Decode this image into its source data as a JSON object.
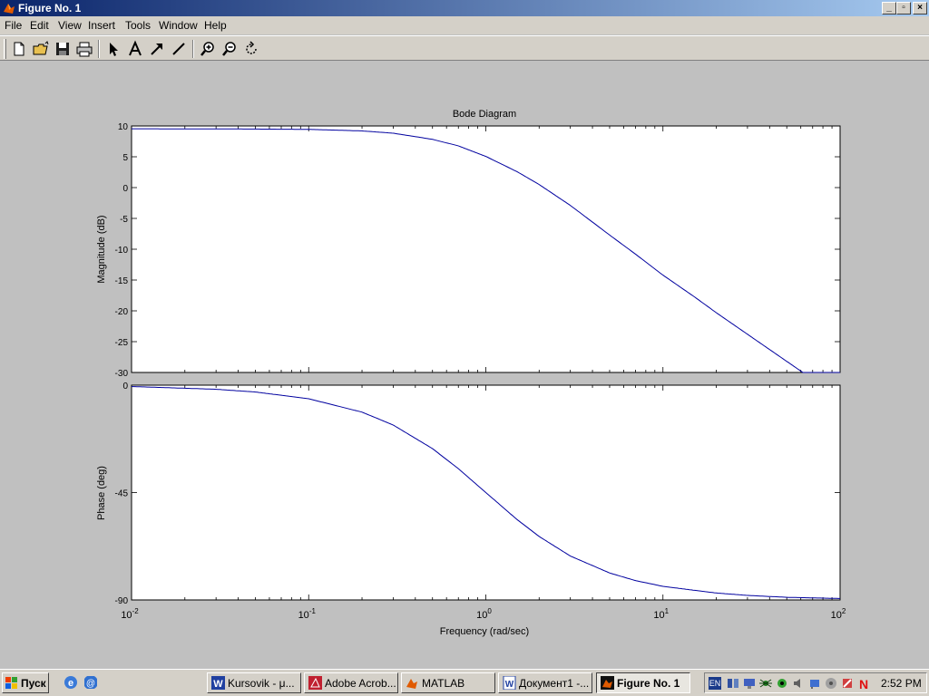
{
  "window": {
    "title": "Figure No. 1",
    "controls": {
      "minimize": "_",
      "maximize": "▫",
      "close": "×"
    }
  },
  "menu": [
    "File",
    "Edit",
    "View",
    "Insert",
    "Tools",
    "Window",
    "Help"
  ],
  "toolbar": [
    "new-file-icon",
    "open-folder-icon",
    "save-icon",
    "print-icon",
    "arrow-select-icon",
    "insert-text-icon",
    "insert-arrow-icon",
    "insert-line-icon",
    "zoom-in-icon",
    "zoom-out-icon",
    "rotate-3d-icon"
  ],
  "chart_data": {
    "type": "line",
    "title": "Bode Diagram",
    "xlabel": "Frequency  (rad/sec)",
    "x_scale": "log",
    "xlim": [
      0.01,
      100
    ],
    "x_ticks": [
      {
        "base": "10",
        "exp": "-2",
        "value": 0.01
      },
      {
        "base": "10",
        "exp": "-1",
        "value": 0.1
      },
      {
        "base": "10",
        "exp": "0",
        "value": 1
      },
      {
        "base": "10",
        "exp": "1",
        "value": 10
      },
      {
        "base": "10",
        "exp": "2",
        "value": 100
      }
    ],
    "line_color": "#00009f",
    "magnitude": {
      "ylabel": "Magnitude (dB)",
      "ylim": [
        -30,
        10
      ],
      "y_ticks": [
        "10",
        "5",
        "0",
        "-5",
        "-10",
        "-15",
        "-20",
        "-25",
        "-30"
      ],
      "x": [
        0.01,
        0.03,
        0.1,
        0.2,
        0.3,
        0.5,
        0.7,
        1,
        1.5,
        2,
        3,
        5,
        7,
        10,
        15,
        20,
        30,
        50,
        70,
        100
      ],
      "y": [
        9.54,
        9.53,
        9.45,
        9.2,
        8.83,
        7.83,
        6.77,
        5.06,
        2.59,
        0.5,
        -2.89,
        -7.7,
        -10.8,
        -14.2,
        -17.7,
        -20.3,
        -23.8,
        -28.2,
        -31.1,
        -34.2
      ]
    },
    "phase": {
      "ylabel": "Phase (deg)",
      "ylim": [
        -90,
        0
      ],
      "y_ticks": [
        "0",
        "-45",
        "-90"
      ],
      "x": [
        0.01,
        0.03,
        0.05,
        0.1,
        0.2,
        0.3,
        0.5,
        0.7,
        1,
        1.5,
        2,
        3,
        5,
        7,
        10,
        20,
        30,
        50,
        100
      ],
      "y": [
        -0.57,
        -1.72,
        -2.86,
        -5.71,
        -11.3,
        -16.7,
        -26.6,
        -35.0,
        -45.0,
        -56.3,
        -63.4,
        -71.6,
        -78.7,
        -81.9,
        -84.3,
        -87.1,
        -88.1,
        -88.9,
        -89.4
      ]
    }
  },
  "taskbar": {
    "start_label": "Пуск",
    "quick_launch": [
      "ie-icon",
      "desktop-icon"
    ],
    "tasks": [
      {
        "label": "Kursovik  - μ...",
        "icon": "word-icon",
        "active": false
      },
      {
        "label": "Adobe Acrob...",
        "icon": "acrobat-icon",
        "active": false
      },
      {
        "label": "MATLAB",
        "icon": "matlab-icon",
        "active": false
      },
      {
        "label": "Документ1 -...",
        "icon": "word-doc-icon",
        "active": false
      },
      {
        "label": "Figure No. 1",
        "icon": "figure-icon",
        "active": true
      }
    ],
    "tray": {
      "lang": "EN",
      "clock": "2:52 PM"
    }
  }
}
